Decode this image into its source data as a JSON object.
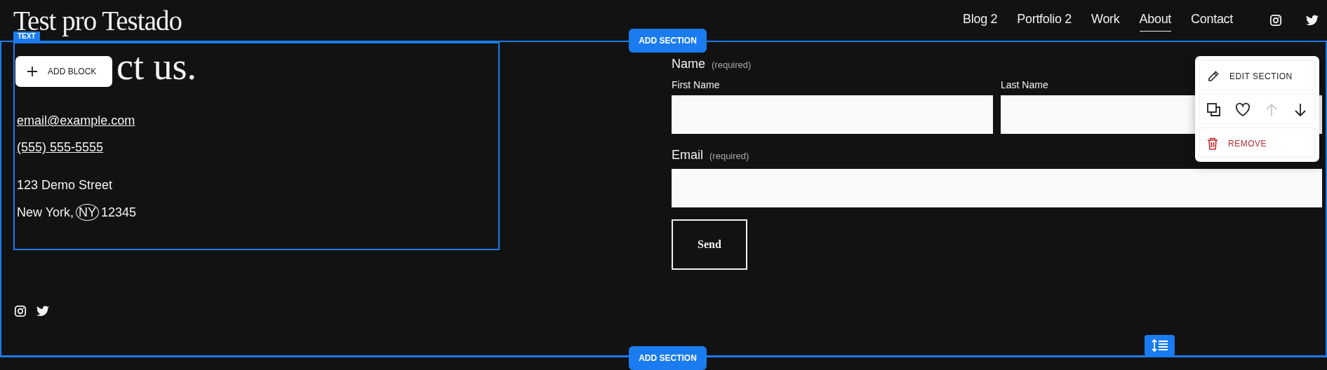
{
  "site_title": "Test pro Testado",
  "nav": [
    {
      "label": "Blog 2",
      "selected": false
    },
    {
      "label": "Portfolio 2",
      "selected": false
    },
    {
      "label": "Work",
      "selected": false
    },
    {
      "label": "About",
      "selected": true
    },
    {
      "label": "Contact",
      "selected": false
    }
  ],
  "editor": {
    "block_tag": "TEXT",
    "add_block": "ADD BLOCK",
    "add_section_top": "ADD SECTION",
    "add_section_bottom": "ADD SECTION",
    "section_menu": {
      "edit": "EDIT SECTION",
      "remove": "REMOVE",
      "tools": [
        {
          "kind": "duplicate",
          "disabled": false
        },
        {
          "kind": "favorite",
          "disabled": false
        },
        {
          "kind": "move-up",
          "disabled": true
        },
        {
          "kind": "move-down",
          "disabled": false
        }
      ]
    }
  },
  "contact": {
    "heading": "ct us.",
    "email": "email@example.com",
    "phone": "(555) 555-5555",
    "address_line1": "123 Demo Street",
    "address_line2": [
      {
        "text": "New York,",
        "circled": false
      },
      {
        "text": "NY",
        "circled": true
      },
      {
        "text": "12345",
        "circled": false
      }
    ]
  },
  "form": {
    "name_label": "Name",
    "name_hint": "(required)",
    "first_label": "First Name",
    "last_label": "Last Name",
    "email_label": "Email",
    "email_hint": "(required)",
    "submit": "Send"
  }
}
